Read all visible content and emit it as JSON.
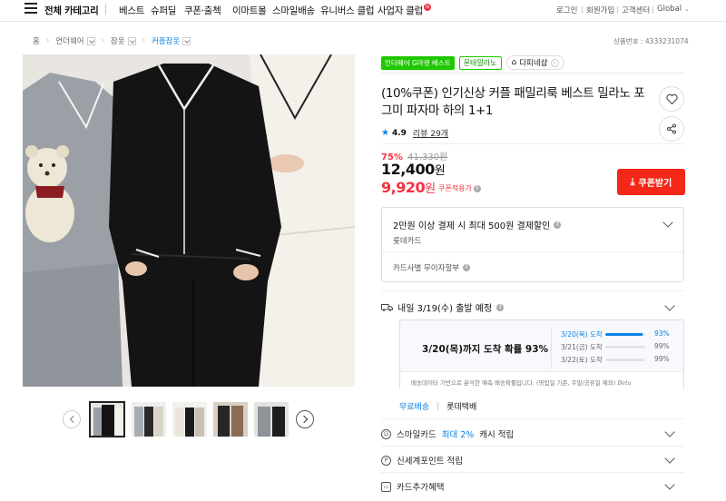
{
  "nav": {
    "all_categories": "전체 카테고리",
    "items": [
      "베스트",
      "슈퍼딜",
      "쿠폰·출첵",
      "이마트몰",
      "스마일배송",
      "유니버스 클럽",
      "사업자 클럽"
    ],
    "new_badge": "N",
    "util": [
      "로그인",
      "회원가입",
      "고객센터",
      "Global"
    ]
  },
  "breadcrumb": [
    "홈",
    "언더웨어",
    "잠옷",
    "커플잠옷"
  ],
  "product_number": "상품번호 : 4333231074",
  "badges": {
    "gmarket": "언더웨어 G마켓 베스트",
    "seller": "몬테밀라노",
    "store": "다피네샵"
  },
  "title": "(10%쿠폰) 인기신상 커플 패밀리룩 베스트 밀라노 포그미 파자마 하의 1+1",
  "rating": {
    "score": "4.9",
    "reviews": "리뷰 29개"
  },
  "price": {
    "discount_pct": "75%",
    "original": "41,330원",
    "sale": "12,400",
    "sale_unit": "원",
    "coupon": "9,920",
    "coupon_unit": "원",
    "coupon_note": "쿠폰적용가",
    "coupon_button": "쿠폰받기"
  },
  "card_benefit": {
    "line1": "2만원 이상 결제 시 최대 500원 결제할인",
    "line2": "롯데카드",
    "line3": "카드사별 무이자할부"
  },
  "shipping": {
    "header": "내일 3/19(수) 출발 예정",
    "probability_text": "3/20(목)까지 도착 확률 93%",
    "rows": [
      {
        "label": "3/20(목) 도착",
        "pct": "93%",
        "value": 0.93
      },
      {
        "label": "3/21(금) 도착",
        "pct": "99%",
        "value": 0.99
      },
      {
        "label": "3/22(토) 도착",
        "pct": "99%",
        "value": 0.99
      }
    ],
    "note": "배송데이터 기반으로 분석한 예측 배송확률입니다. (영업일 기준, 주말/공휴일 제외)",
    "beta": "Beta",
    "tab_free": "무료배송",
    "tab_carrier": "롯데택배"
  },
  "benefits": {
    "smile_prefix": "스마일카드",
    "smile_blue": "최대 2%",
    "smile_suffix": "캐시 적립",
    "shinsegae": "신세계포인트 적립",
    "card_extra": "카드추가혜택"
  },
  "colors": {
    "accent_red": "#f42819",
    "accent_blue": "#0b83e6",
    "gmarket_green": "#1ec800"
  }
}
